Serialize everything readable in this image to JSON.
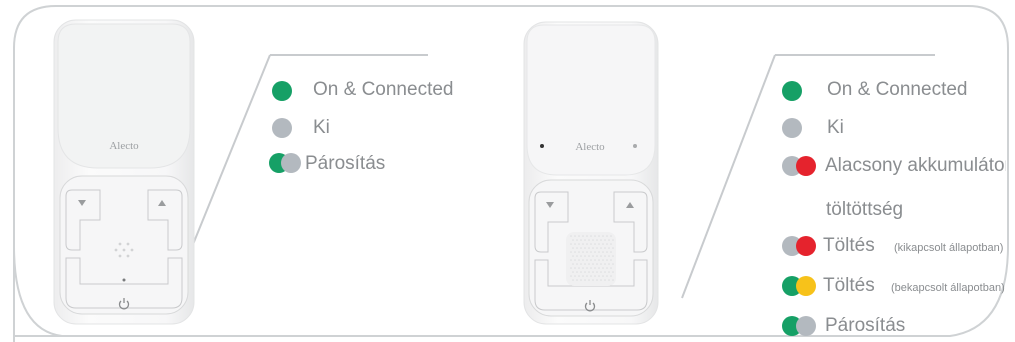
{
  "colors": {
    "green": "#16a066",
    "gray": "#b3b9bf",
    "red": "#e5232d",
    "yellow": "#f7c21a",
    "text": "#8a8d90",
    "frame": "#cfd2d4"
  },
  "left_device": {
    "brand": "Alecto",
    "icons": [
      "chevron-down-icon",
      "chevron-up-icon",
      "power-icon"
    ]
  },
  "right_device": {
    "brand": "Alecto",
    "icons": [
      "chevron-down-icon",
      "chevron-up-icon",
      "power-icon"
    ]
  },
  "left_legend": [
    {
      "label": "On & Connected",
      "indicator": [
        "green"
      ]
    },
    {
      "label": "Ki",
      "indicator": [
        "gray"
      ]
    },
    {
      "label": "Párosítás",
      "indicator": [
        "green",
        "gray"
      ]
    }
  ],
  "right_legend": [
    {
      "label": "On & Connected",
      "indicator": [
        "green"
      ]
    },
    {
      "label": "Ki",
      "indicator": [
        "gray"
      ]
    },
    {
      "label": "Alacsony akkumulátor",
      "indicator": [
        "gray",
        "red"
      ]
    },
    {
      "label": "töltöttség"
    },
    {
      "label": "Töltés",
      "note": "(kikapcsolt állapotban)",
      "indicator": [
        "gray",
        "red"
      ]
    },
    {
      "label": "Töltés",
      "note": "(bekapcsolt állapotban)",
      "indicator": [
        "green",
        "yellow"
      ]
    },
    {
      "label": "Párosítás",
      "indicator": [
        "green",
        "gray"
      ]
    }
  ]
}
